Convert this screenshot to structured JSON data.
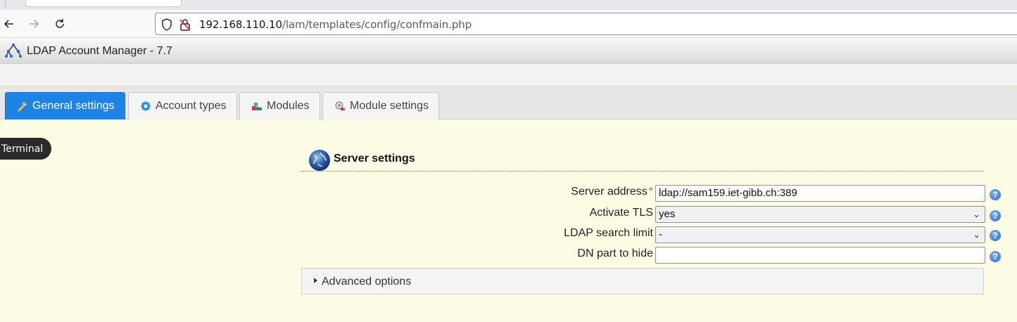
{
  "browser": {
    "url_host": "192.168.110.10",
    "url_path": "/lam/templates/config/confmain.php"
  },
  "app": {
    "title": "LDAP Account Manager - 7.7"
  },
  "tabs": [
    {
      "label": "General settings",
      "icon": "wrench-icon",
      "active": true
    },
    {
      "label": "Account types",
      "icon": "gear-icon",
      "active": false
    },
    {
      "label": "Modules",
      "icon": "blocks-icon",
      "active": false
    },
    {
      "label": "Module settings",
      "icon": "module-settings-icon",
      "active": false
    }
  ],
  "terminal": {
    "label": "Terminal"
  },
  "server_settings": {
    "title": "Server settings",
    "fields": {
      "server_address": {
        "label": "Server address",
        "required_mark": "*",
        "value": "ldap://sam159.iet-gibb.ch:389"
      },
      "activate_tls": {
        "label": "Activate TLS",
        "value": "yes"
      },
      "search_limit": {
        "label": "LDAP search limit",
        "value": "-"
      },
      "dn_part": {
        "label": "DN part to hide",
        "value": ""
      }
    },
    "help_glyph": "?"
  },
  "advanced": {
    "label": "Advanced options"
  },
  "colors": {
    "active_tab": "#1d84e6",
    "page_bg": "#fdfde6",
    "required": "#e25d1a"
  }
}
